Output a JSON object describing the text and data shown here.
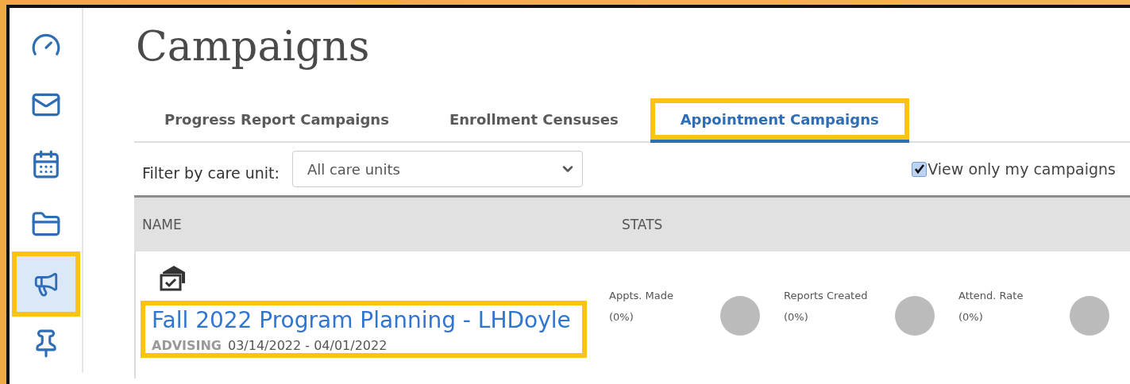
{
  "sidebar": {
    "items": [
      {
        "kind": "dashboard",
        "selected": false,
        "highlighted": false
      },
      {
        "kind": "mail",
        "selected": false,
        "highlighted": false
      },
      {
        "kind": "calendar",
        "selected": false,
        "highlighted": false
      },
      {
        "kind": "folder",
        "selected": false,
        "highlighted": false
      },
      {
        "kind": "campaigns",
        "selected": true,
        "highlighted": true
      },
      {
        "kind": "pin",
        "selected": false,
        "highlighted": false
      }
    ]
  },
  "page": {
    "title": "Campaigns"
  },
  "tabs": [
    {
      "label": "Progress Report Campaigns",
      "selected": false,
      "highlighted": false
    },
    {
      "label": "Enrollment Censuses",
      "selected": false,
      "highlighted": false
    },
    {
      "label": "Appointment Campaigns",
      "selected": true,
      "highlighted": true
    }
  ],
  "filter": {
    "label": "Filter by care unit:",
    "value": "All care units"
  },
  "only_mine": {
    "label": "View only my campaigns",
    "checked": true
  },
  "table": {
    "columns": [
      "NAME",
      "STATS"
    ],
    "rows": [
      {
        "name": "Fall 2022 Program Planning - LHDoyle",
        "category": "ADVISING",
        "dates": "03/14/2022 - 04/01/2022",
        "highlighted": true,
        "stats": [
          {
            "label": "Appts. Made",
            "value": "(0%)"
          },
          {
            "label": "Reports Created",
            "value": "(0%)"
          },
          {
            "label": "Attend. Rate",
            "value": "(0%)"
          }
        ]
      }
    ]
  }
}
